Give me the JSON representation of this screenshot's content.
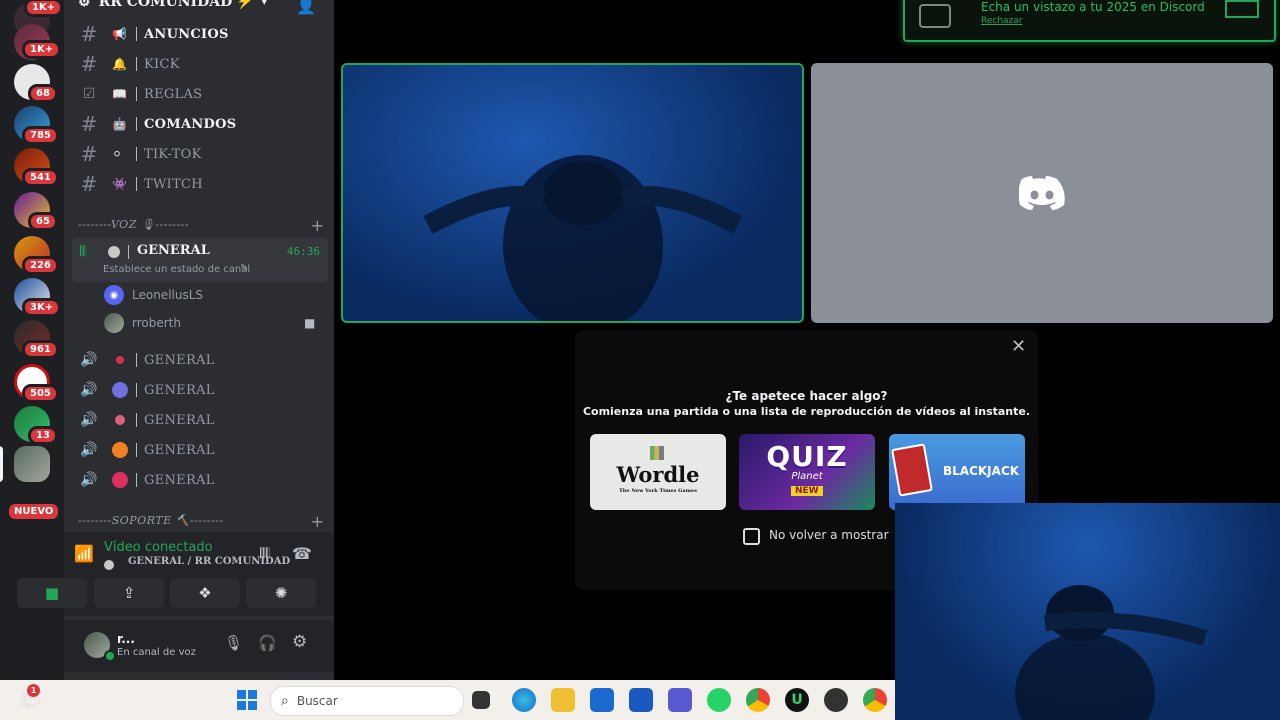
{
  "server_rail": {
    "badges": [
      "1K+",
      "1K+",
      "68",
      "785",
      "541",
      "65",
      "226",
      "3K+",
      "961",
      "505",
      "13"
    ],
    "new_label": "NUEVO"
  },
  "server": {
    "name": "RR COMUNIDAD",
    "name_emoji": "⚡"
  },
  "text_channels": [
    {
      "name": "ANUNCIOS",
      "emoji": "📢",
      "unread": true
    },
    {
      "name": "KICK",
      "emoji": "🔔",
      "unread": false
    },
    {
      "name": "REGLAS",
      "emoji": "📖",
      "unread": false
    },
    {
      "name": "COMANDOS",
      "emoji": "🤖",
      "unread": true
    },
    {
      "name": "TIK-TOK",
      "emoji": "⚪",
      "unread": false
    },
    {
      "name": "TWITCH",
      "emoji": "👾",
      "unread": false
    }
  ],
  "voice_category": "--------VOZ 🎙--------",
  "active_voice": {
    "name": "GENERAL",
    "timer": "46:36",
    "status_hint": "Establece un estado de canal",
    "users": [
      "LeonellusLS",
      "rroberth"
    ]
  },
  "voice_channels": [
    "GENERAL",
    "GENERAL",
    "GENERAL",
    "GENERAL",
    "GENERAL"
  ],
  "support_category": "--------SOPORTE 🔨--------",
  "voice_panel": {
    "status": "Vídeo conectado",
    "location": "GENERAL / RR COMUNIDAD"
  },
  "user": {
    "name": "r...",
    "status": "En canal de voz"
  },
  "banner": {
    "text": "Echa un vistazo a tu 2025 en Discord",
    "dismiss": "Rechazar"
  },
  "activity_popup": {
    "title": "¿Te apetece hacer algo?",
    "subtitle": "Comienza una partida o una lista de reproducción de vídeos al instante.",
    "activities": [
      {
        "name": "Wordle",
        "sub": "The New York Times Games"
      },
      {
        "name": "QUIZ",
        "sub": "Planet",
        "tag": "NEW"
      },
      {
        "name": "BLACKJACK"
      }
    ],
    "checkbox_label": "No volver a mostrar"
  },
  "taskbar": {
    "search_placeholder": "Buscar",
    "notification_count": "1"
  },
  "colors": {
    "accent_green": "#23a55a",
    "badge_red": "#da373c",
    "discord_tile": "#8a8f98"
  }
}
